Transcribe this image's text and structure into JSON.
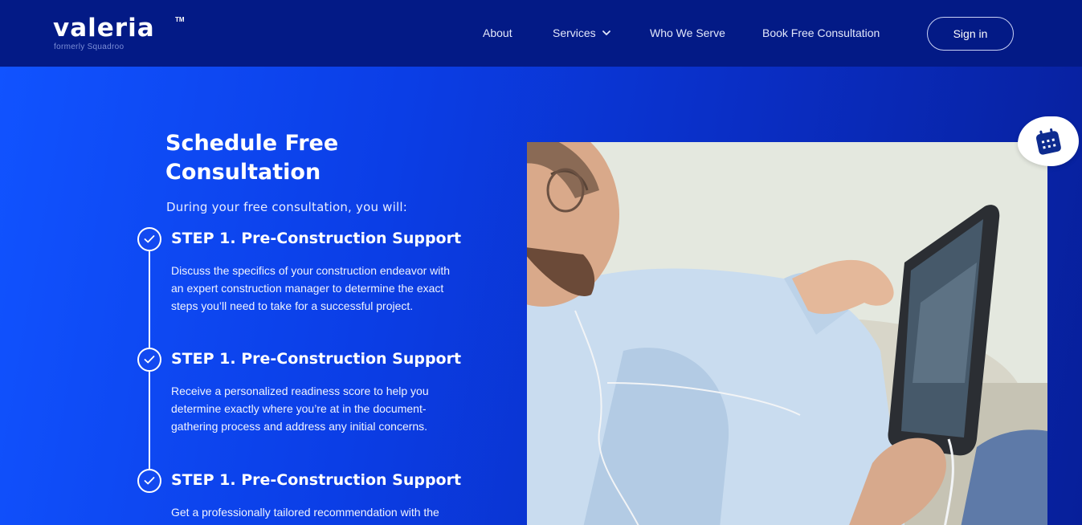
{
  "brand": {
    "name": "valeria",
    "tm": "TM",
    "subtitle": "formerly Squadroo"
  },
  "nav": {
    "items": [
      {
        "label": "About"
      },
      {
        "label": "Services"
      },
      {
        "label": "Who We Serve"
      },
      {
        "label": "Book Free Consultation"
      }
    ],
    "signin_label": "Sign in"
  },
  "hero": {
    "title": "Schedule Free Consultation",
    "intro": "During your free consultation, you will:",
    "steps": [
      {
        "title": "STEP 1. Pre-Construction Support",
        "description": "Discuss the specifics of your construction endeavor with an expert construction manager to determine the exact steps you’ll need to take for a successful project."
      },
      {
        "title": "STEP 1. Pre-Construction Support",
        "description": "Receive a personalized readiness score to help you determine exactly where you’re at in the document-gathering process and address any initial concerns."
      },
      {
        "title": "STEP 1. Pre-Construction Support",
        "description": "Get a professionally tailored recommendation with the"
      }
    ]
  },
  "icons": {
    "check": "check-icon",
    "calendar": "calendar-icon",
    "chevron": "chevron-down-icon"
  },
  "colors": {
    "header_bg": "#031a86",
    "hero_start": "#1153ff",
    "hero_end": "#071f9a",
    "text": "#ffffff"
  }
}
